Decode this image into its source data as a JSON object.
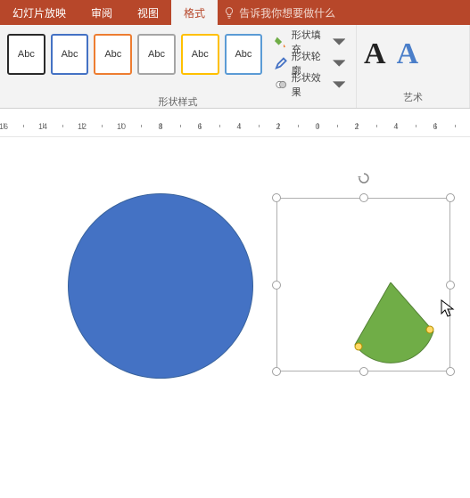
{
  "tabs": {
    "slideshow": "幻灯片放映",
    "review": "审阅",
    "view": "视图",
    "format": "格式"
  },
  "tell_me": "告诉我你想要做什么",
  "ribbon": {
    "shape_styles_label": "形状样式",
    "style_text": "Abc",
    "shape_fill": "形状填充",
    "shape_outline": "形状轮廓",
    "shape_effects": "形状效果",
    "wordart_label": "艺术",
    "wordart_A": "A"
  },
  "ruler": {
    "nums": [
      "16",
      "14",
      "12",
      "10",
      "8",
      "6",
      "4",
      "2",
      "0",
      "2",
      "4",
      "6"
    ]
  },
  "shapes": {
    "circle_color": "#4472c4",
    "pie_color": "#70ad47"
  }
}
